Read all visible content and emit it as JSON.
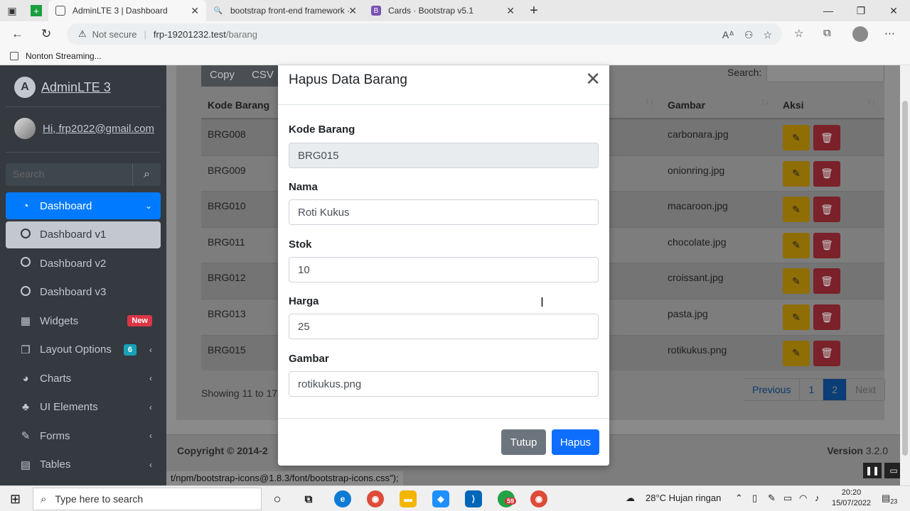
{
  "browser": {
    "tabs": [
      {
        "title": "AdminLTE 3 | Dashboard",
        "active": true
      },
      {
        "title": "bootstrap front-end framework ·",
        "active": false
      },
      {
        "title": "Cards · Bootstrap v5.1",
        "active": false
      }
    ],
    "not_secure": "Not secure",
    "url_host": "frp-19201232.test",
    "url_path": "/barang",
    "bookmark": "Nonton Streaming..."
  },
  "sidebar": {
    "brand": "AdminLTE 3",
    "brand_logo": "A",
    "user": "Hi, frp2022@gmail.com",
    "search_placeholder": "Search",
    "items": [
      {
        "label": "Dashboard"
      },
      {
        "label": "Dashboard v1"
      },
      {
        "label": "Dashboard v2"
      },
      {
        "label": "Dashboard v3"
      },
      {
        "label": "Widgets",
        "badge": "New"
      },
      {
        "label": "Layout Options",
        "badge": "6"
      },
      {
        "label": "Charts"
      },
      {
        "label": "UI Elements"
      },
      {
        "label": "Forms"
      },
      {
        "label": "Tables"
      }
    ]
  },
  "table": {
    "buttons": [
      "Copy",
      "CSV"
    ],
    "search_label": "Search:",
    "headers": {
      "code": "Kode Barang",
      "image": "Gambar",
      "action": "Aksi"
    },
    "rows": [
      {
        "code": "BRG008",
        "image": "carbonara.jpg"
      },
      {
        "code": "BRG009",
        "image": "onionring.jpg"
      },
      {
        "code": "BRG010",
        "image": "macaroon.jpg"
      },
      {
        "code": "BRG011",
        "image": "chocolate.jpg"
      },
      {
        "code": "BRG012",
        "image": "croissant.jpg"
      },
      {
        "code": "BRG013",
        "image": "pasta.jpg"
      },
      {
        "code": "BRG015",
        "image": "rotikukus.png"
      }
    ],
    "showing": "Showing 11 to 17",
    "pager": {
      "prev": "Previous",
      "p1": "1",
      "p2": "2",
      "next": "Next"
    }
  },
  "footer": {
    "copyright": "Copyright © 2014-2",
    "version_label": "Version",
    "version": "3.2.0"
  },
  "status_tip": "t/npm/bootstrap-icons@1.8.3/font/bootstrap-icons.css\");",
  "modal": {
    "title": "Hapus Data Barang",
    "fields": {
      "kode": {
        "label": "Kode Barang",
        "value": "BRG015"
      },
      "nama": {
        "label": "Nama",
        "value": "Roti Kukus"
      },
      "stok": {
        "label": "Stok",
        "value": "10"
      },
      "harga": {
        "label": "Harga",
        "value": "25"
      },
      "gambar": {
        "label": "Gambar",
        "value": "rotikukus.png"
      }
    },
    "close_label": "Tutup",
    "delete_label": "Hapus"
  },
  "taskbar": {
    "search_placeholder": "Type here to search",
    "weather": "28°C  Hujan ringan",
    "time": "20:20",
    "date": "15/07/2022",
    "whatsapp_badge": "59",
    "notif_count": "23"
  },
  "colors": {
    "primary": "#007bff",
    "sidebar": "#343a40",
    "danger": "#dc3545",
    "warning": "#ffc107",
    "modal_primary": "#0d6efd"
  }
}
